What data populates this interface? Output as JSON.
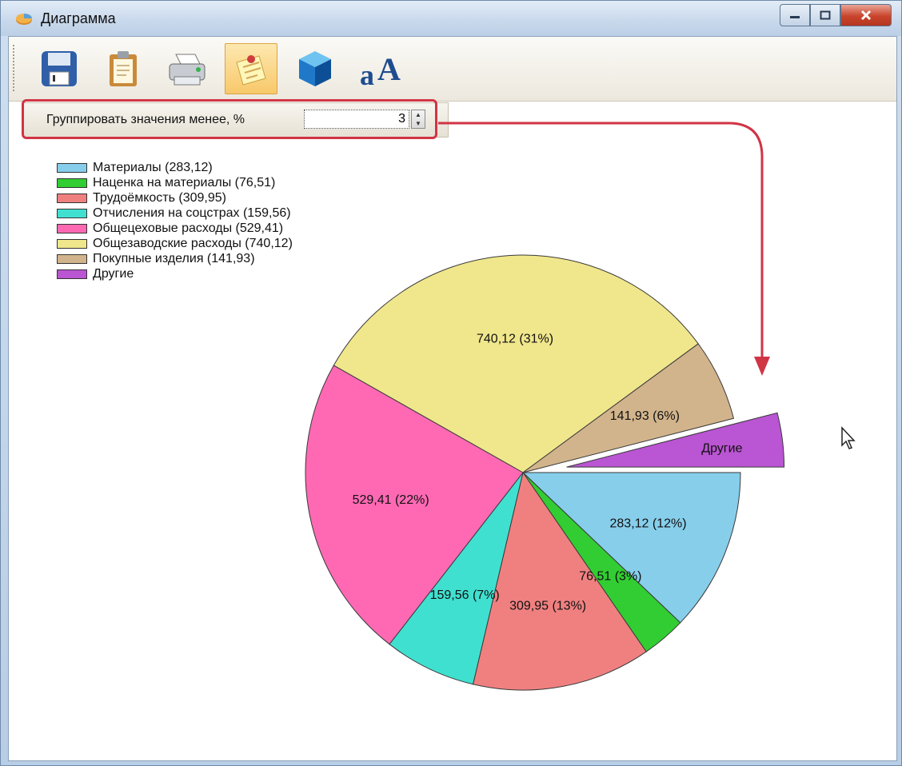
{
  "window": {
    "title": "Диаграмма"
  },
  "toolbar": {
    "buttons": [
      {
        "icon": "save-icon"
      },
      {
        "icon": "clipboard-icon"
      },
      {
        "icon": "print-icon"
      },
      {
        "icon": "notes-icon",
        "active": true
      },
      {
        "icon": "3d-cube-icon"
      },
      {
        "icon": "font-icon"
      }
    ]
  },
  "grouping": {
    "label": "Группировать значения менее, %",
    "value": "3"
  },
  "colors": {
    "highlight": "#d03545"
  },
  "chart_data": {
    "type": "pie",
    "legend_position": "top-left",
    "slices": [
      {
        "legend": "Материалы (283,12)",
        "value": 283.12,
        "label": "283,12 (12%)",
        "color": "#87ceeb",
        "exploded": false
      },
      {
        "legend": "Наценка на материалы (76,51)",
        "value": 76.51,
        "label": "76,51 (3%)",
        "color": "#32cd32",
        "exploded": false
      },
      {
        "legend": "Трудоёмкость (309,95)",
        "value": 309.95,
        "label": "309,95 (13%)",
        "color": "#f08080",
        "exploded": false
      },
      {
        "legend": "Отчисления на соцстрах (159,56)",
        "value": 159.56,
        "label": "159,56 (7%)",
        "color": "#40e0d0",
        "exploded": false
      },
      {
        "legend": "Общецеховые расходы (529,41)",
        "value": 529.41,
        "label": "529,41 (22%)",
        "color": "#ff69b4",
        "exploded": false
      },
      {
        "legend": "Общезаводские расходы (740,12)",
        "value": 740.12,
        "label": "740,12 (31%)",
        "color": "#f0e68c",
        "exploded": false
      },
      {
        "legend": "Покупные изделия (141,93)",
        "value": 141.93,
        "label": "141,93 (6%)",
        "color": "#d2b48c",
        "exploded": false
      },
      {
        "legend": "Другие",
        "value": 93.5,
        "label": "Другие",
        "color": "#ba55d3",
        "exploded": true
      }
    ]
  }
}
